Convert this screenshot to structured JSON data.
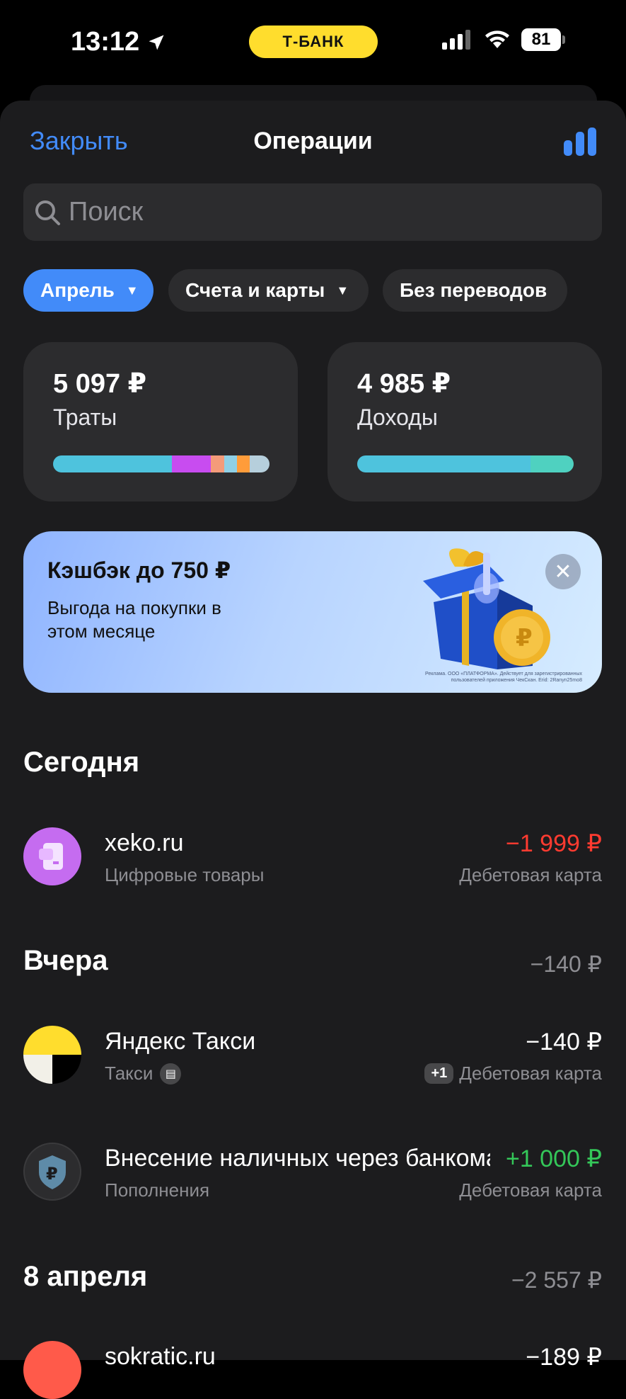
{
  "status_bar": {
    "time": "13:12",
    "bank_pill": "Т-БАНК",
    "battery": "81"
  },
  "nav": {
    "close_label": "Закрыть",
    "title": "Операции"
  },
  "search": {
    "placeholder": "Поиск"
  },
  "filters": [
    {
      "label": "Апрель",
      "active": true
    },
    {
      "label": "Счета и карты",
      "active": false
    },
    {
      "label": "Без переводов",
      "active": false
    }
  ],
  "summary": {
    "spending": {
      "amount": "5 097 ₽",
      "label": "Траты",
      "segments": [
        {
          "color": "#4ec3dd",
          "share": 0.55
        },
        {
          "color": "#c84cf0",
          "share": 0.18
        },
        {
          "color": "#f49b7a",
          "share": 0.06
        },
        {
          "color": "#8fd0e6",
          "share": 0.06
        },
        {
          "color": "#ff9c3a",
          "share": 0.06
        },
        {
          "color": "#b6cfdc",
          "share": 0.09
        }
      ]
    },
    "income": {
      "amount": "4 985 ₽",
      "label": "Доходы",
      "segments": [
        {
          "color": "#4ec3dd",
          "share": 0.8
        },
        {
          "color": "#4fd1c0",
          "share": 0.2
        }
      ]
    }
  },
  "promo": {
    "title": "Кэшбэк до 750 ₽",
    "subtitle": "Выгода на покупки в этом месяце",
    "fine_print": "Реклама. ООО «ПЛАТФОРМА». Действует для зарегистрированных пользователей приложения ЧекСкан. Erid: 2Ranyn25mo8"
  },
  "sections": {
    "today": {
      "title": "Сегодня"
    },
    "yesterday": {
      "title": "Вчера",
      "total": "−140 ₽"
    },
    "april8": {
      "title": "8 апреля",
      "total": "−2 557 ₽"
    }
  },
  "operations": {
    "xeko": {
      "title": "xeko.ru",
      "category": "Цифровые товары",
      "amount": "−1 999 ₽",
      "source": "Дебетовая карта"
    },
    "taxi": {
      "title": "Яндекс Такси",
      "category": "Такси",
      "amount": "−140 ₽",
      "badge": "+1",
      "source": "Дебетовая карта"
    },
    "cash": {
      "title": "Внесение наличных через банкомат",
      "category": "Пополнения",
      "amount": "+1 000 ₽",
      "source": "Дебетовая карта"
    },
    "sokratic": {
      "title": "sokratic.ru",
      "amount": "−189 ₽"
    }
  },
  "colors": {
    "accent": "#428bf9",
    "negative": "#ff3b30",
    "positive": "#34c759",
    "brand_yellow": "#ffdd2d"
  }
}
